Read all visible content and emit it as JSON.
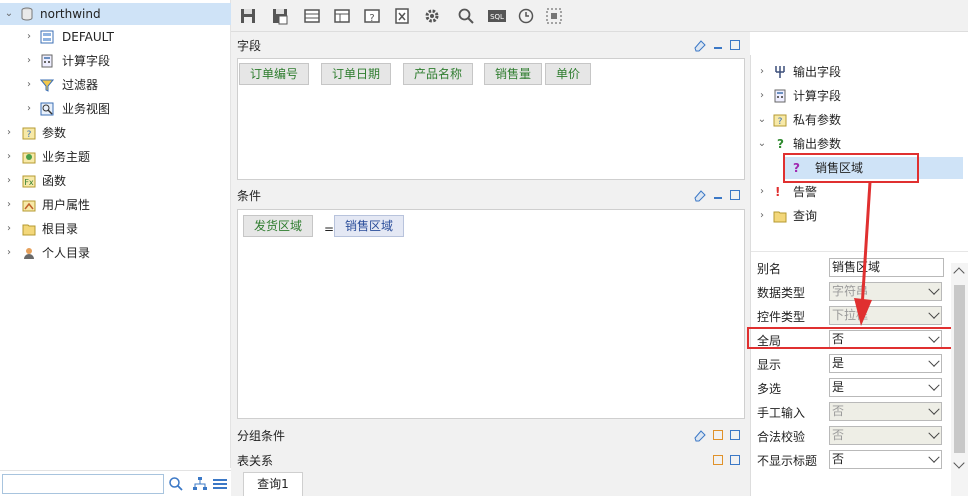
{
  "tree": {
    "root": "northwind",
    "children": [
      "DEFAULT",
      "计算字段",
      "过滤器",
      "业务视图"
    ],
    "top": [
      "参数",
      "业务主题",
      "函数",
      "用户属性",
      "根目录",
      "个人目录"
    ]
  },
  "sections": {
    "fields_title": "字段",
    "conditions_title": "条件",
    "group_title": "分组条件",
    "relation_title": "表关系"
  },
  "fields": [
    "订单编号",
    "订单日期",
    "产品名称",
    "销售量",
    "单价"
  ],
  "condition": {
    "left": "发货区域",
    "op": "=",
    "right": "销售区域"
  },
  "bottom_tab": "查询1",
  "right_tree": {
    "items": [
      "输出字段",
      "计算字段",
      "私有参数",
      "输出参数"
    ],
    "selected_child": "销售区域",
    "after": [
      "告警",
      "查询"
    ]
  },
  "props": [
    {
      "label": "别名",
      "value": "销售区域",
      "disabled": false,
      "dropdown": false
    },
    {
      "label": "数据类型",
      "value": "字符串",
      "disabled": true,
      "dropdown": true
    },
    {
      "label": "控件类型",
      "value": "下拉框",
      "disabled": true,
      "dropdown": true
    },
    {
      "label": "全局",
      "value": "否",
      "disabled": false,
      "dropdown": true
    },
    {
      "label": "显示",
      "value": "是",
      "disabled": false,
      "dropdown": true
    },
    {
      "label": "多选",
      "value": "是",
      "disabled": false,
      "dropdown": true
    },
    {
      "label": "手工输入",
      "value": "否",
      "disabled": true,
      "dropdown": true
    },
    {
      "label": "合法校验",
      "value": "否",
      "disabled": true,
      "dropdown": true
    },
    {
      "label": "不显示标题",
      "value": "否",
      "disabled": false,
      "dropdown": true
    }
  ],
  "colors": {
    "highlight": "#e03030",
    "selected": "#cfe3f7",
    "chip_text": "#2f7d2f",
    "chip_blue_text": "#2a4d9a"
  }
}
